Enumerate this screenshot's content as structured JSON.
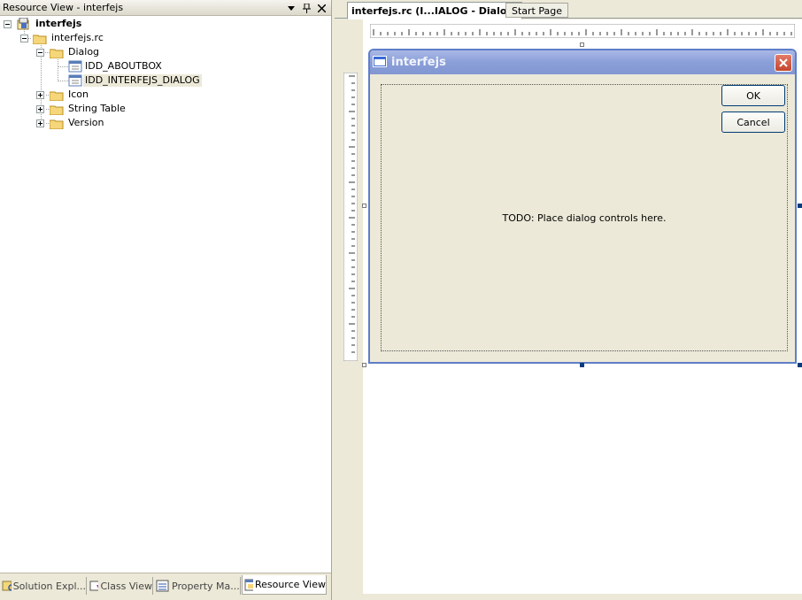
{
  "resource_view": {
    "title": "Resource View - interfejs",
    "tree": {
      "root": "interfejs",
      "rc_file": "interfejs.rc",
      "dialog_folder": "Dialog",
      "dialog_items": [
        "IDD_ABOUTBOX",
        "IDD_INTERFEJS_DIALOG"
      ],
      "folders": [
        "Icon",
        "String Table",
        "Version"
      ]
    },
    "bottom_tabs": [
      "Solution Expl...",
      "Class View",
      "Property Ma...",
      "Resource View"
    ]
  },
  "editor": {
    "tabs": [
      "interfejs.rc (I...IALOG - Dialog)",
      "Start Page"
    ],
    "dialog": {
      "title": "interfejs",
      "ok_label": "OK",
      "cancel_label": "Cancel",
      "placeholder_text": "TODO: Place dialog controls here."
    }
  },
  "colors": {
    "chrome": "#ece9d8",
    "dialog_title_gradient": "#8a9fd8",
    "close_button": "#c3462c",
    "button_border": "#003c74"
  }
}
